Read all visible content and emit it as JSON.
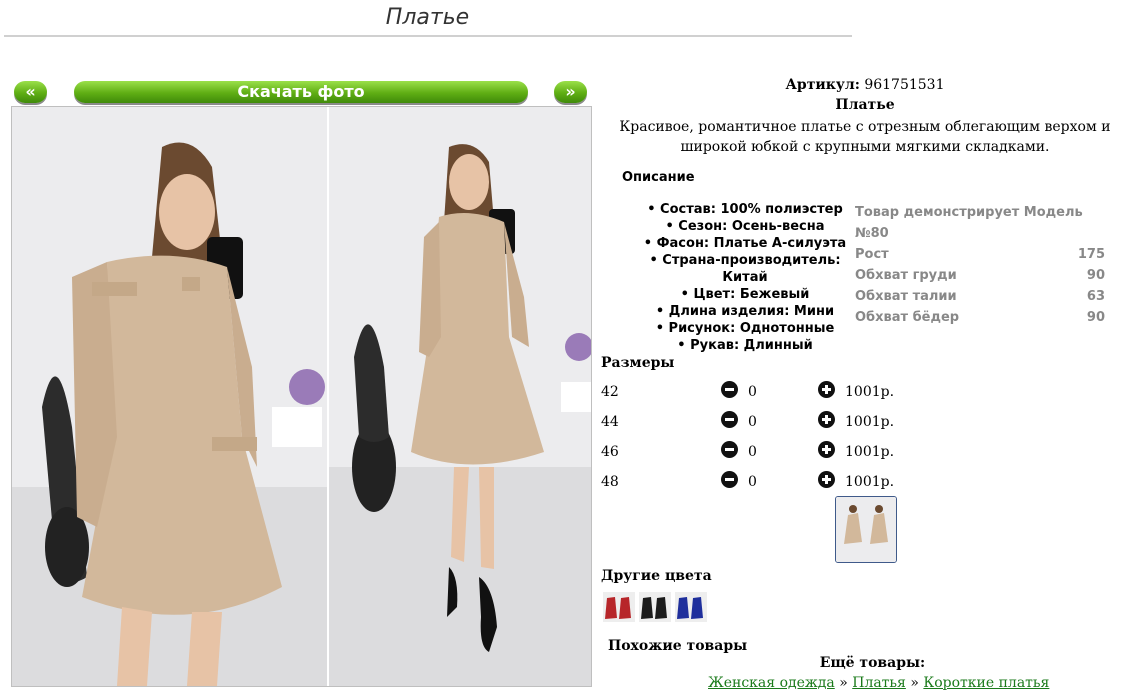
{
  "page": {
    "title": "Платье"
  },
  "gallery": {
    "prev_label": "«",
    "download_label": "Скачать фото",
    "next_label": "»"
  },
  "product": {
    "article_label": "Артикул:",
    "article_value": "961751531",
    "name": "Платье",
    "description": "Красивое, романтичное платье с отрезным облегающим верхом и широкой юбкой с крупными мягкими складками."
  },
  "description_heading": "Описание",
  "properties": [
    "Состав: 100% полиэстер",
    "Сезон: Осень-весна",
    "Фасон: Платье А-силуэта",
    "Страна-производитель: Китай",
    "Цвет: Бежевый",
    "Длина изделия: Мини",
    "Рисунок: Однотонные",
    "Рукав: Длинный"
  ],
  "model": {
    "heading": "Товар демонстрирует Модель №80",
    "rows": [
      {
        "label": "Рост",
        "value": "175"
      },
      {
        "label": "Обхват груди",
        "value": "90"
      },
      {
        "label": "Обхват талии",
        "value": "63"
      },
      {
        "label": "Обхват бёдер",
        "value": "90"
      }
    ]
  },
  "sizes_heading": "Размеры",
  "sizes": [
    {
      "size": "42",
      "qty": "0",
      "price": "1001р."
    },
    {
      "size": "44",
      "qty": "0",
      "price": "1001р."
    },
    {
      "size": "46",
      "qty": "0",
      "price": "1001р."
    },
    {
      "size": "48",
      "qty": "0",
      "price": "1001р."
    }
  ],
  "other_colors_heading": "Другие цвета",
  "similar_heading": "Похожие товары",
  "more_heading": "Ещё товары:",
  "breadcrumb": {
    "items": [
      "Женская одежда",
      "Платья",
      "Короткие платья"
    ],
    "separator": "»"
  },
  "colors": {
    "accent_green": "#5fae14",
    "link_green": "#1a7a1a",
    "dress_beige": "#d2b89b"
  }
}
